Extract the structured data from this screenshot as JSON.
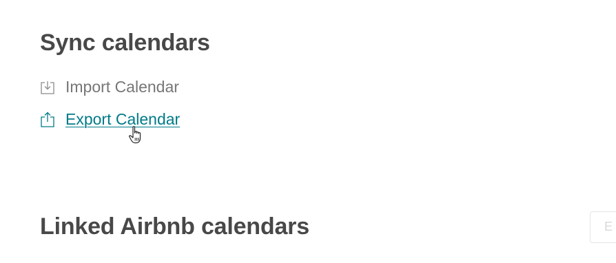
{
  "sync_section": {
    "title": "Sync calendars",
    "import_label": "Import Calendar",
    "import_icon": "import-icon",
    "export_label": "Export Calendar",
    "export_icon": "export-icon",
    "link_color": "#007a87"
  },
  "linked_section": {
    "title": "Linked Airbnb calendars",
    "button_label": "E"
  },
  "cursor": "hand-pointer-icon"
}
